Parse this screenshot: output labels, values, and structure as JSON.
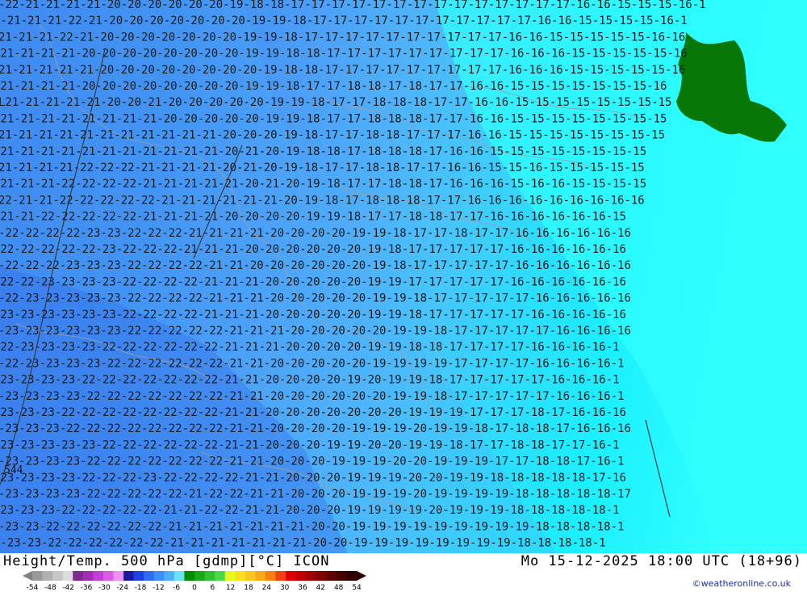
{
  "map": {
    "title": "Height/Temp. 500 hPa [gdmp][°C] ICON",
    "valid_time": "Mo 15-12-2025 18:00 UTC (18+96)",
    "credit": "©weatheronline.co.uk",
    "height_contour_label": "544",
    "colors": {
      "temp_le_-24": "#3a7fef",
      "temp_-23": "#3e8bf2",
      "temp_-22": "#4b9ef8",
      "temp_-21": "#4fb1fb",
      "temp_-20": "#46c6fd",
      "temp_-19": "#2edcff",
      "temp_-18_-17": "#1af0ff",
      "temp_ge_-16": "#30ffff",
      "orography": "#077707",
      "contour_line": "#9e9e9e",
      "label_text": "#1b1b1b"
    },
    "temperature_labels": [
      {
        "row": 0,
        "text": "-22-21-21-21-21-20-20-20-20-20-20-19-18-18-17-17-17-17-17-17-17-17-17-17-17-17-17-17-16-16-15-15-15-16-1"
      },
      {
        "row": 1,
        "text": "1-21-21-21-22-21-20-20-20-20-20-20-20-19-19-18-17-17-17-17-17-17-17-17-17-17-17-16-16-15-15-15-15-16-1"
      },
      {
        "row": 2,
        "text": "21-21-21-22-21-20-20-20-20-20-20-20-19-19-18-17-17-17-17-17-17-17-17-17-17-16-16-15-15-15-15-15-16-16"
      },
      {
        "row": 3,
        "text": "-21-21-21-21-20-20-20-20-20-20-20-20-19-19-18-18-17-17-17-17-17-17-17-17-17-16-16-16-15-15-15-15-15-16"
      },
      {
        "row": 4,
        "text": "21-21-21-21-21-20-20-20-20-20-20-20-20-19-18-18-17-17-17-17-17-17-17-17-17-16-16-16-15-15-15-15-15-16"
      },
      {
        "row": 5,
        "text": "-21-21-21-21-20-20-20-20-20-20-20-20-19-19-18-17-17-18-18-17-18-17-17-16-16-15-15-15-15-15-15-15-16"
      },
      {
        "row": 6,
        "text": "L21-21-21-21-21-20-20-21-20-20-20-20-20-19-19-18-17-17-18-18-18-17-17-16-16-15-15-15-15-15-15-15-15"
      },
      {
        "row": 7,
        "text": "-21-21-21-21-21-21-21-21-20-20-20-20-20-19-19-18-17-17-18-18-18-17-17-16-16-15-15-15-15-15-15-15-15"
      },
      {
        "row": 8,
        "text": "21-21-21-21-21-21-21-21-21-21-21-20-20-20-19-18-17-17-18-18-17-17-17-16-16-15-15-15-15-15-15-15-15"
      },
      {
        "row": 9,
        "text": "-21-21-21-21-21-21-21-21-21-21-21-20-21-20-19-18-18-17-18-18-18-17-16-16-15-15-15-15-15-15-15-15"
      },
      {
        "row": 10,
        "text": "21-21-21-21-22-22-22-21-21-21-21-20-21-20-19-18-17-17-18-18-17-17-16-16-15-15-16-15-15-15-15-15"
      },
      {
        "row": 11,
        "text": "-21-21-21-22-22-22-22-21-21-21-21-21-20-21-20-19-18-17-17-18-18-17-16-16-16-15-16-16-15-15-15-15"
      },
      {
        "row": 12,
        "text": "22-21-21-22-22-22-22-22-21-21-21-21-21-21-20-19-18-17-18-18-18-17-17-16-16-16-16-16-16-16-16-16"
      },
      {
        "row": 13,
        "text": "-21-21-22-22-22-22-22-21-21-21-21-20-20-20-20-19-19-18-17-17-18-18-17-17-16-16-16-16-16-16-15"
      },
      {
        "row": 14,
        "text": "-22-22-22-22-23-23-22-22-22-21-21-21-21-20-20-20-20-19-19-18-17-17-18-17-17-16-16-16-16-16-16"
      },
      {
        "row": 15,
        "text": "-22-22-22-22-22-23-22-22-22-21-21-21-20-20-20-20-20-20-19-18-17-17-17-17-17-16-16-16-16-16-16"
      },
      {
        "row": 16,
        "text": "-22-22-22-23-23-23-22-22-22-22-21-21-20-20-20-20-20-20-19-18-17-17-17-17-17-16-16-16-16-16-16"
      },
      {
        "row": 17,
        "text": "-22-22-23-23-23-23-22-22-22-22-21-21-21-20-20-20-20-20-19-19-17-17-17-17-17-16-16-16-16-16-16"
      },
      {
        "row": 18,
        "text": "-22-23-23-23-23-23-22-22-22-22-21-21-21-20-20-20-20-20-19-19-18-17-17-17-17-17-16-16-16-16-16"
      },
      {
        "row": 19,
        "text": "-23-23-23-23-23-23-22-22-22-22-21-21-21-20-20-20-20-20-19-19-18-17-17-17-17-17-16-16-16-16-16"
      },
      {
        "row": 20,
        "text": "-23-23-23-23-23-23-22-22-22-22-22-21-21-21-20-20-20-20-20-19-19-18-17-17-17-17-17-16-16-16-16"
      },
      {
        "row": 21,
        "text": "-22-23-23-23-23-22-22-22-22-22-22-21-21-21-20-20-20-20-19-19-18-18-17-17-17-17-16-16-16-16-1"
      },
      {
        "row": 22,
        "text": "-22-23-23-23-23-22-22-22-22-22-22-21-21-20-20-20-20-20-19-19-19-19-17-17-17-17-16-16-16-16-1"
      },
      {
        "row": 23,
        "text": "-23-23-23-23-22-22-22-22-22-22-22-21-21-20-20-20-20-19-20-19-19-18-17-17-17-17-17-16-16-16-1"
      },
      {
        "row": 24,
        "text": "-23-23-23-23-22-22-22-22-22-22-22-21-21-20-20-20-20-20-20-19-19-18-17-17-17-17-17-16-16-16-1"
      },
      {
        "row": 25,
        "text": "-23-23-23-22-22-22-22-22-22-22-22-21-21-20-20-20-20-20-20-20-19-19-19-17-17-17-18-17-16-16-16"
      },
      {
        "row": 26,
        "text": "-23-23-23-22-22-22-22-22-22-22-22-21-21-20-20-20-20-19-19-19-20-19-19-18-17-18-18-17-16-16-16"
      },
      {
        "row": 27,
        "text": "-23-23-23-23-23-22-22-22-22-22-22-21-21-20-20-20-19-19-20-20-19-19-18-17-17-18-18-17-17-16-1"
      },
      {
        "row": 28,
        "text": "-23-23-23-23-22-22-22-22-22-22-22-21-21-20-20-20-19-19-19-20-20-19-19-19-17-17-18-18-17-16-1"
      },
      {
        "row": 29,
        "text": "-23-23-23-23-22-22-22-23-22-22-22-22-21-21-20-20-20-19-19-19-20-20-19-19-18-18-18-18-18-17-16"
      },
      {
        "row": 30,
        "text": "-23-23-23-23-22-22-22-22-22-21-22-22-21-21-20-20-20-19-19-19-20-19-19-19-19-18-18-18-18-18-17"
      },
      {
        "row": 31,
        "text": "-23-23-23-22-22-22-22-22-21-21-22-22-21-21-20-20-20-19-19-19-19-20-19-19-19-18-18-18-18-18-1"
      },
      {
        "row": 32,
        "text": "-23-23-22-22-22-22-22-22-21-21-21-21-21-21-21-20-20-19-19-19-19-19-19-19-19-19-18-18-18-18-1"
      },
      {
        "row": 33,
        "text": "3-23-23-22-22-22-22-22-22-21-21-21-21-21-21-21-20-20-19-19-19-19-19-19-19-19-18-18-18-18-1"
      }
    ]
  },
  "legend": {
    "ticks": [
      "-54",
      "-48",
      "-42",
      "-36",
      "-30",
      "-24",
      "-18",
      "-12",
      "-6",
      "0",
      "6",
      "12",
      "18",
      "24",
      "30",
      "36",
      "42",
      "48",
      "54"
    ],
    "colors": [
      "#9a9a9a",
      "#b0b0b0",
      "#c6c6c6",
      "#dcdcdc",
      "#7d2a8e",
      "#a02fb4",
      "#c03fd4",
      "#dc5ae8",
      "#f090f0",
      "#1a1aa0",
      "#2040e0",
      "#2f6cf0",
      "#3e8ff7",
      "#4dafff",
      "#6ee0ff",
      "#008a00",
      "#18a818",
      "#30c030",
      "#48d848",
      "#e8f820",
      "#f8e020",
      "#f8c820",
      "#f8a818",
      "#f88010",
      "#f04010",
      "#e00000",
      "#c00000",
      "#a00000",
      "#800000",
      "#600000",
      "#480000",
      "#300000"
    ]
  }
}
